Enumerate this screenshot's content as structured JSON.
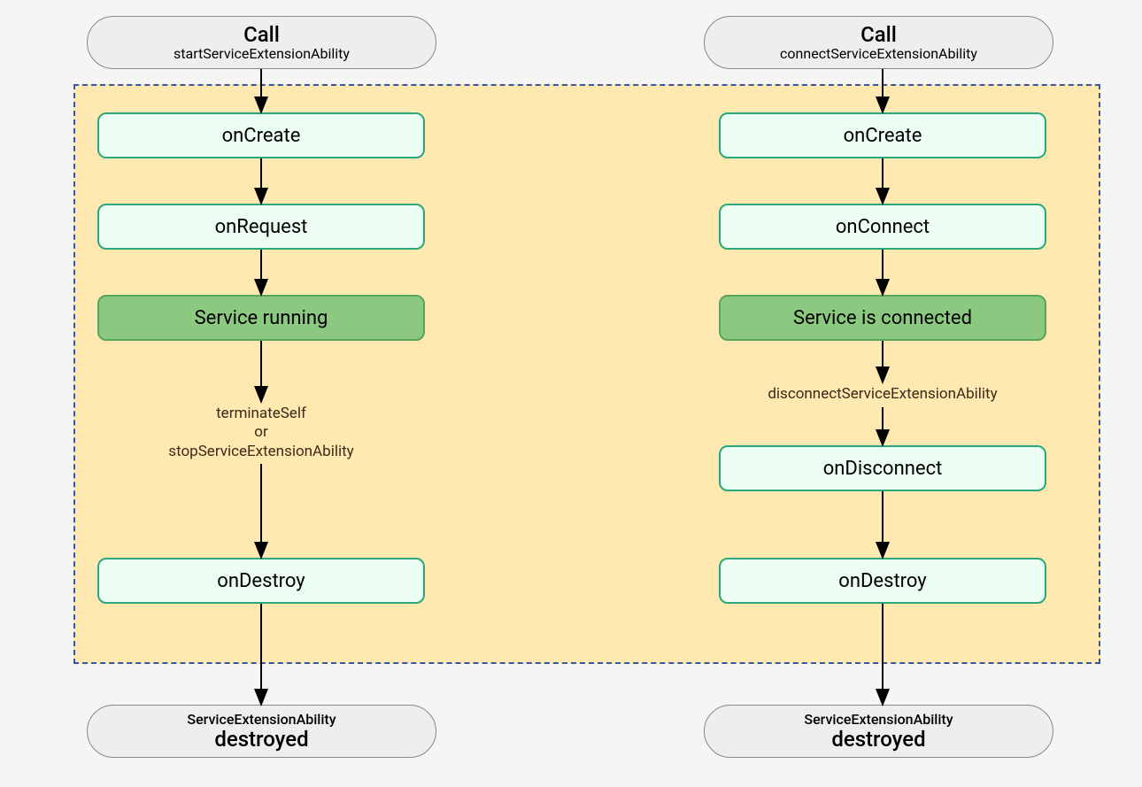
{
  "left_flow": {
    "start": {
      "line1": "Call",
      "line2": "startServiceExtensionAbility"
    },
    "on_create": "onCreate",
    "on_request": "onRequest",
    "running": "Service running",
    "edge_stop": {
      "line1": "terminateSelf",
      "line2": "or",
      "line3": "stopServiceExtensionAbility"
    },
    "on_destroy": "onDestroy",
    "end": {
      "line1": "ServiceExtensionAbility",
      "line2": "destroyed"
    }
  },
  "right_flow": {
    "start": {
      "line1": "Call",
      "line2": "connectServiceExtensionAbility"
    },
    "on_create": "onCreate",
    "on_connect": "onConnect",
    "connected": "Service is connected",
    "edge_disconnect": "disconnectServiceExtensionAbility",
    "on_disconnect": "onDisconnect",
    "on_destroy": "onDestroy",
    "end": {
      "line1": "ServiceExtensionAbility",
      "line2": "destroyed"
    }
  }
}
